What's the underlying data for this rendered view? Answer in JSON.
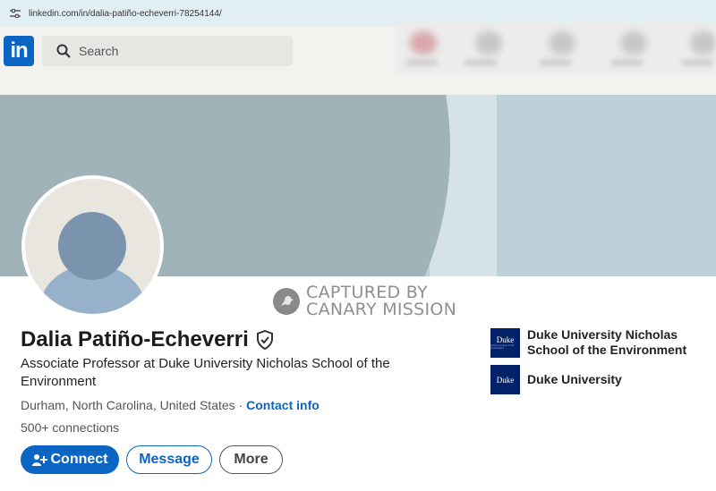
{
  "browser": {
    "url": "linkedin.com/in/dalia-patiño-echeverri-78254144/"
  },
  "nav": {
    "logo_text": "in",
    "search_placeholder": "Search"
  },
  "watermark": {
    "line1": "CAPTURED BY",
    "line2": "CANARY MISSION"
  },
  "profile": {
    "name": "Dalia Patiño-Echeverri",
    "headline": "Associate Professor at Duke University Nicholas School of the Environment",
    "location": "Durham, North Carolina, United States",
    "separator": " · ",
    "contact_label": "Contact info",
    "connections": "500+ connections"
  },
  "actions": {
    "connect": "Connect",
    "message": "Message",
    "more": "More"
  },
  "education": [
    {
      "name": "Duke University Nicholas School of the Environment",
      "logo_text": "Duke",
      "logo_sub": "NICHOLAS SCHOOL OF THE ENVIRONMENT"
    },
    {
      "name": "Duke University",
      "logo_text": "Duke"
    }
  ],
  "colors": {
    "brand": "#0a66c2",
    "banner": "#bcd1d8",
    "duke_blue": "#012169"
  }
}
